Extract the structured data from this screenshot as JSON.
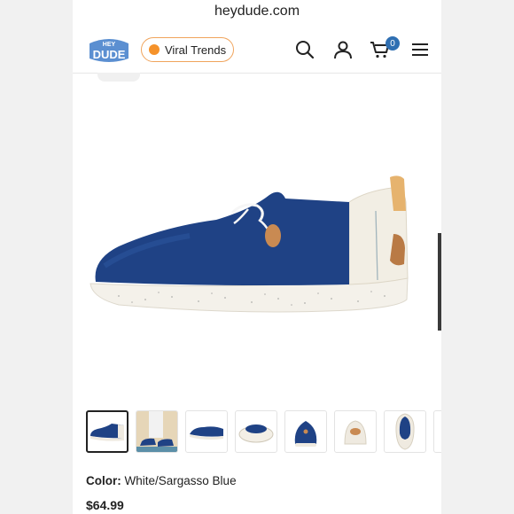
{
  "browser": {
    "url": "heydude.com"
  },
  "header": {
    "logo_top": "HEY",
    "logo_bottom": "DUDE",
    "trend_label": "Viral Trends",
    "cart_count": "0",
    "icons": [
      "search-icon",
      "account-icon",
      "cart-icon",
      "menu-icon"
    ]
  },
  "colors": {
    "brand_blue": "#5b8fd1",
    "trend_orange": "#f5922a",
    "badge_blue": "#2f6fb2",
    "shoe_navy": "#1f4285",
    "sole_white": "#f4f1ea"
  },
  "gallery": {
    "thumbnail_count": 8,
    "active_index": 0
  },
  "product": {
    "color_label": "Color:",
    "color_value": "White/Sargasso Blue",
    "price": "$64.99"
  }
}
